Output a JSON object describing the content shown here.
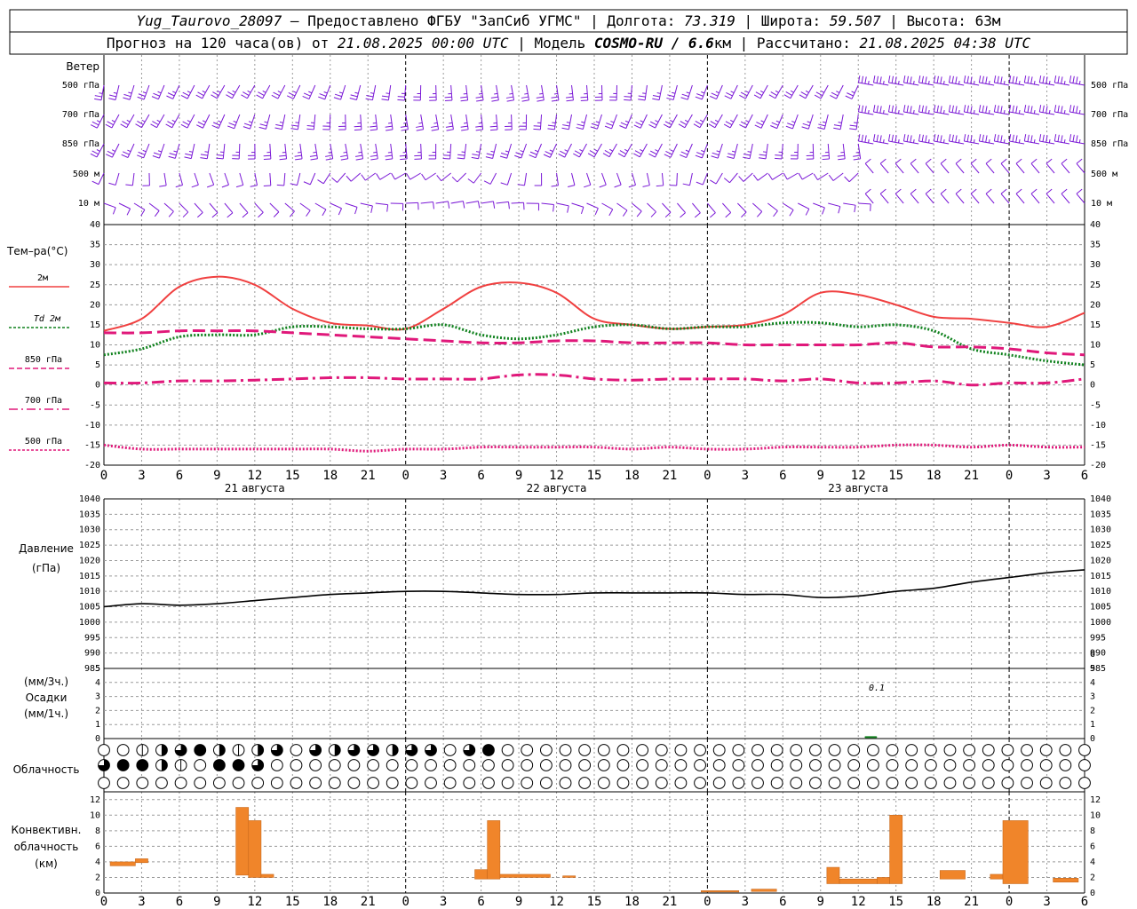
{
  "header": {
    "line1": {
      "station": "Yug_Taurovo_28097",
      "provider": " – Предоставлено ФГБУ \"ЗапСиб УГМС\" | Долгота: ",
      "lon": "73.319",
      "lat_label": " | Широта: ",
      "lat": "59.507",
      "alt_label": " | Высота: 63м"
    },
    "line2": {
      "forecast_label": "Прогноз на 120 часа(ов) от ",
      "forecast_start": "21.08.2025 00:00 UTC",
      "model_label": " | Модель ",
      "model": "COSMO-RU / 6.6",
      "model_unit": "км",
      "computed_label": " | Рассчитано: ",
      "computed": "21.08.2025 04:38 UTC"
    }
  },
  "labels": {
    "wind": "Ветер",
    "wind_levels": [
      "500 гПа",
      "700 гПа",
      "850 гПа",
      "500 м",
      "10 м"
    ],
    "temp_title": "Тем–ра(°C)",
    "temp_legend": [
      "2м",
      "Td 2м",
      "850 гПа",
      "700 гПа",
      "500 гПа"
    ],
    "pressure_title": "Давление",
    "pressure_unit": "(гПа)",
    "precip_top": "(мм/3ч.)",
    "precip_title": "Осадки",
    "precip_bottom": "(мм/1ч.)",
    "precip_note": "0.1",
    "cloud_title": "Облачность",
    "conv_line1": "Конвективн.",
    "conv_line2": "облачность",
    "conv_line3": "(км)"
  },
  "colors": {
    "wind": "#7a18d6",
    "t2m": "#f04040",
    "td2m": "#10821e",
    "t850": "#e0187a",
    "t700": "#e0187a",
    "t500": "#e0187a",
    "pressure": "#000000",
    "convective": "#f0852a",
    "grid": "#9a9a9a"
  },
  "chart_data": [
    {
      "type": "line",
      "panel": "temperature",
      "x_hours": [
        0,
        3,
        6,
        9,
        12,
        15,
        18,
        21,
        24,
        27,
        30,
        33,
        36,
        39,
        42,
        45,
        48,
        51,
        54,
        57,
        60,
        63,
        66,
        69,
        72,
        75,
        78
      ],
      "x_tick_labels": [
        "0",
        "3",
        "6",
        "9",
        "12",
        "15",
        "18",
        "21",
        "0",
        "3",
        "6",
        "9",
        "12",
        "15",
        "18",
        "21",
        "0",
        "3",
        "6",
        "9",
        "12",
        "15",
        "18",
        "21",
        "0",
        "3",
        "6"
      ],
      "day_labels": [
        {
          "hour": 12,
          "text": "21 августа"
        },
        {
          "hour": 36,
          "text": "22 августа"
        },
        {
          "hour": 60,
          "text": "23 августа"
        }
      ],
      "ylim": [
        -20,
        40
      ],
      "y_ticks": [
        -20,
        -15,
        -10,
        -5,
        0,
        5,
        10,
        15,
        20,
        25,
        30,
        35,
        40
      ],
      "series": [
        {
          "name": "2м",
          "style": "solid",
          "values": [
            13.5,
            16.5,
            24.5,
            27.0,
            25.0,
            19.0,
            15.5,
            14.8,
            14.0,
            19.0,
            24.5,
            25.5,
            23.0,
            16.5,
            15.0,
            14.0,
            14.5,
            15.0,
            17.5,
            23.0,
            22.5,
            20.0,
            17.0,
            16.5,
            15.5,
            14.5,
            18.0
          ]
        },
        {
          "name": "Td 2м",
          "style": "dotted",
          "values": [
            7.5,
            9.0,
            12.0,
            12.5,
            12.5,
            14.5,
            14.5,
            14.0,
            14.0,
            15.0,
            12.5,
            11.5,
            12.5,
            14.5,
            15.0,
            14.0,
            14.5,
            14.5,
            15.5,
            15.5,
            14.5,
            15.0,
            13.5,
            9.0,
            7.5,
            6.0,
            5.0
          ]
        },
        {
          "name": "850 гПа",
          "style": "dashed",
          "values": [
            13.0,
            13.0,
            13.5,
            13.5,
            13.5,
            13.0,
            12.5,
            12.0,
            11.5,
            11.0,
            10.5,
            10.5,
            11.0,
            11.0,
            10.5,
            10.5,
            10.5,
            10.0,
            10.0,
            10.0,
            10.0,
            10.5,
            9.5,
            9.5,
            9.0,
            8.0,
            7.5
          ]
        },
        {
          "name": "700 гПа",
          "style": "dashdot",
          "values": [
            0.5,
            0.5,
            1.0,
            1.0,
            1.2,
            1.5,
            1.8,
            1.8,
            1.5,
            1.5,
            1.5,
            2.5,
            2.5,
            1.5,
            1.2,
            1.5,
            1.5,
            1.5,
            1.0,
            1.5,
            0.5,
            0.5,
            1.0,
            0.0,
            0.5,
            0.5,
            1.5
          ]
        },
        {
          "name": "500 гПа",
          "style": "dotted",
          "values": [
            -15.0,
            -16.0,
            -16.0,
            -16.0,
            -16.0,
            -16.0,
            -16.0,
            -16.5,
            -16.0,
            -16.0,
            -15.5,
            -15.5,
            -15.5,
            -15.5,
            -16.0,
            -15.5,
            -16.0,
            -16.0,
            -15.5,
            -15.5,
            -15.5,
            -15.0,
            -15.0,
            -15.5,
            -15.0,
            -15.5,
            -15.5
          ]
        }
      ]
    },
    {
      "type": "line",
      "panel": "pressure",
      "x_hours": [
        0,
        3,
        6,
        9,
        12,
        15,
        18,
        21,
        24,
        27,
        30,
        33,
        36,
        39,
        42,
        45,
        48,
        51,
        54,
        57,
        60,
        63,
        66,
        69,
        72,
        75,
        78
      ],
      "ylim": [
        985,
        1040
      ],
      "y_ticks": [
        985,
        990,
        995,
        1000,
        1005,
        1010,
        1015,
        1020,
        1025,
        1030,
        1035,
        1040
      ],
      "series": [
        {
          "name": "",
          "values": [
            1005.0,
            1006.0,
            1005.5,
            1006.0,
            1007.0,
            1008.0,
            1009.0,
            1009.5,
            1010.0,
            1010.0,
            1009.5,
            1009.0,
            1009.0,
            1009.5,
            1009.5,
            1009.5,
            1009.5,
            1009.0,
            1009.0,
            1008.0,
            1008.5,
            1010.0,
            1011.0,
            1013.0,
            1014.5,
            1016.0,
            1017.0
          ]
        }
      ]
    },
    {
      "type": "bar",
      "panel": "precipitation",
      "ylim": [
        0,
        5
      ],
      "y_ticks_left": [
        0,
        1,
        2,
        3,
        4,
        5
      ],
      "y_ticks_right": [
        0,
        1,
        2,
        3,
        4,
        5,
        6
      ],
      "x_hours": [
        61
      ],
      "values": [
        0.1
      ]
    },
    {
      "type": "table",
      "panel": "cloudiness",
      "columns_per_row": 52,
      "rows": [
        [
          0,
          0,
          1,
          2,
          3,
          4,
          2,
          1,
          2,
          3,
          0,
          3,
          2,
          3,
          3,
          2,
          3,
          3,
          0,
          3,
          4,
          0,
          0,
          0,
          0,
          0,
          0,
          0,
          0,
          0,
          0,
          0,
          0,
          0,
          0,
          0,
          0,
          0,
          0,
          0,
          0,
          0,
          0,
          0,
          0,
          0,
          0,
          0,
          0,
          0,
          0,
          0
        ],
        [
          3,
          4,
          4,
          2,
          1,
          0,
          4,
          4,
          3,
          0,
          0,
          0,
          0,
          0,
          0,
          0,
          0,
          0,
          0,
          0,
          0,
          0,
          0,
          0,
          0,
          0,
          0,
          0,
          0,
          0,
          0,
          0,
          0,
          0,
          0,
          0,
          0,
          0,
          0,
          0,
          0,
          0,
          0,
          0,
          0,
          0,
          0,
          0,
          0,
          0,
          0,
          0
        ],
        [
          0,
          0,
          0,
          0,
          0,
          0,
          0,
          0,
          0,
          0,
          0,
          0,
          0,
          0,
          0,
          0,
          0,
          0,
          0,
          0,
          0,
          0,
          0,
          0,
          0,
          0,
          0,
          0,
          0,
          0,
          0,
          0,
          0,
          0,
          0,
          0,
          0,
          0,
          0,
          0,
          0,
          0,
          0,
          0,
          0,
          0,
          0,
          0,
          0,
          0,
          0,
          0
        ]
      ]
    },
    {
      "type": "bar",
      "panel": "convective_cloudiness",
      "ylim": [
        0,
        13
      ],
      "y_ticks": [
        0,
        2,
        4,
        6,
        8,
        10,
        12
      ],
      "bars": [
        {
          "x_start": 0.5,
          "x_end": 2.5,
          "bottom": 3.5,
          "top": 4.0
        },
        {
          "x_start": 2.5,
          "x_end": 3.5,
          "bottom": 3.9,
          "top": 4.4
        },
        {
          "x_start": 10.5,
          "x_end": 11.5,
          "bottom": 2.3,
          "top": 11.0
        },
        {
          "x_start": 11.5,
          "x_end": 12.5,
          "bottom": 2.0,
          "top": 9.3
        },
        {
          "x_start": 12.5,
          "x_end": 13.5,
          "bottom": 2.0,
          "top": 2.4
        },
        {
          "x_start": 29.5,
          "x_end": 30.5,
          "bottom": 1.8,
          "top": 3.0
        },
        {
          "x_start": 30.5,
          "x_end": 31.5,
          "bottom": 1.8,
          "top": 9.3
        },
        {
          "x_start": 31.5,
          "x_end": 35.5,
          "bottom": 2.0,
          "top": 2.4
        },
        {
          "x_start": 36.5,
          "x_end": 37.5,
          "bottom": 2.0,
          "top": 2.2
        },
        {
          "x_start": 47.5,
          "x_end": 50.5,
          "bottom": 0.2,
          "top": 0.3
        },
        {
          "x_start": 51.5,
          "x_end": 53.5,
          "bottom": 0.2,
          "top": 0.5
        },
        {
          "x_start": 57.5,
          "x_end": 58.5,
          "bottom": 1.2,
          "top": 3.3
        },
        {
          "x_start": 58.5,
          "x_end": 61.5,
          "bottom": 1.2,
          "top": 1.8
        },
        {
          "x_start": 61.5,
          "x_end": 62.5,
          "bottom": 1.2,
          "top": 2.0
        },
        {
          "x_start": 62.5,
          "x_end": 63.5,
          "bottom": 1.2,
          "top": 10.0
        },
        {
          "x_start": 66.5,
          "x_end": 68.5,
          "bottom": 1.8,
          "top": 2.9
        },
        {
          "x_start": 70.5,
          "x_end": 71.5,
          "bottom": 1.8,
          "top": 2.4
        },
        {
          "x_start": 71.5,
          "x_end": 73.5,
          "bottom": 1.2,
          "top": 9.3
        },
        {
          "x_start": 75.5,
          "x_end": 77.5,
          "bottom": 1.4,
          "top": 1.9
        }
      ]
    }
  ]
}
